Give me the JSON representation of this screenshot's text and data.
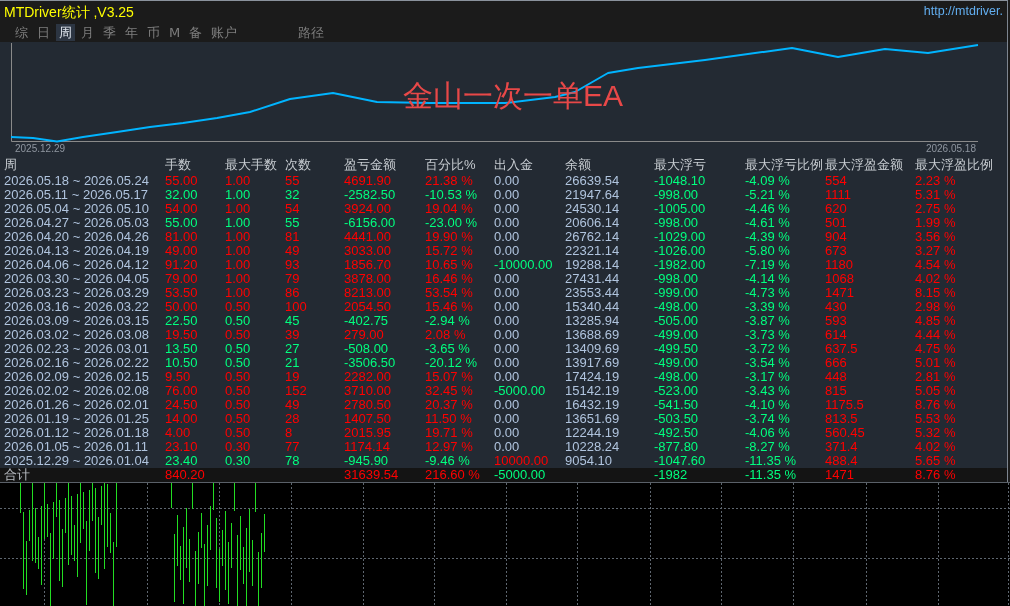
{
  "window": {
    "title": "MTDriver统计 ,V3.25",
    "url": "http://mtdriver."
  },
  "tabs": [
    {
      "label": "综",
      "selected": false
    },
    {
      "label": "日",
      "selected": false
    },
    {
      "label": "周",
      "selected": true
    },
    {
      "label": "月",
      "selected": false
    },
    {
      "label": "季",
      "selected": false
    },
    {
      "label": "年",
      "selected": false
    },
    {
      "label": "币",
      "selected": false
    },
    {
      "label": "M",
      "selected": false
    },
    {
      "label": "备",
      "selected": false
    },
    {
      "label": "账户",
      "selected": false
    }
  ],
  "tool_tabs": [
    {
      "label": "路径",
      "selected": false
    }
  ],
  "equity_chart": {
    "title": "金山一次一单EA",
    "x_start_label": "2025.12.29",
    "x_end_label": "2026.05.18"
  },
  "table": {
    "columns": [
      "周",
      "手数",
      "最大手数",
      "次数",
      "盈亏金额",
      "百分比%",
      "出入金",
      "余额",
      "最大浮亏",
      "最大浮亏比例",
      "最大浮盈金额",
      "最大浮盈比例"
    ],
    "rows": [
      {
        "week": "2026.05.18 ~ 2026.05.24",
        "color": "#ff0000",
        "lots": "55.00",
        "max_lots": "1.00",
        "trades": "55",
        "profit": "4691.90",
        "percent": "21.38 %",
        "deposit": {
          "text": "0.00",
          "color": "#b0c4de"
        },
        "balance": "26639.54",
        "max_float_loss": "-1048.10",
        "max_float_loss_pct": "-4.09 %",
        "max_float_profit": "554",
        "max_float_profit_pct": "2.23 %"
      },
      {
        "week": "2026.05.11 ~ 2026.05.17",
        "color": "#00ff7f",
        "lots": "32.00",
        "max_lots": "1.00",
        "trades": "32",
        "profit": "-2582.50",
        "percent": "-10.53 %",
        "deposit": {
          "text": "0.00",
          "color": "#b0c4de"
        },
        "balance": "21947.64",
        "max_float_loss": "-998.00",
        "max_float_loss_pct": "-5.21 %",
        "max_float_profit": "1111",
        "max_float_profit_pct": "5.31 %"
      },
      {
        "week": "2026.05.04 ~ 2026.05.10",
        "color": "#ff0000",
        "lots": "54.00",
        "max_lots": "1.00",
        "trades": "54",
        "profit": "3924.00",
        "percent": "19.04 %",
        "deposit": {
          "text": "0.00",
          "color": "#b0c4de"
        },
        "balance": "24530.14",
        "max_float_loss": "-1005.00",
        "max_float_loss_pct": "-4.46 %",
        "max_float_profit": "620",
        "max_float_profit_pct": "2.75 %"
      },
      {
        "week": "2026.04.27 ~ 2026.05.03",
        "color": "#00ff7f",
        "lots": "55.00",
        "max_lots": "1.00",
        "trades": "55",
        "profit": "-6156.00",
        "percent": "-23.00 %",
        "deposit": {
          "text": "0.00",
          "color": "#b0c4de"
        },
        "balance": "20606.14",
        "max_float_loss": "-998.00",
        "max_float_loss_pct": "-4.61 %",
        "max_float_profit": "501",
        "max_float_profit_pct": "1.99 %"
      },
      {
        "week": "2026.04.20 ~ 2026.04.26",
        "color": "#ff0000",
        "lots": "81.00",
        "max_lots": "1.00",
        "trades": "81",
        "profit": "4441.00",
        "percent": "19.90 %",
        "deposit": {
          "text": "0.00",
          "color": "#b0c4de"
        },
        "balance": "26762.14",
        "max_float_loss": "-1029.00",
        "max_float_loss_pct": "-4.39 %",
        "max_float_profit": "904",
        "max_float_profit_pct": "3.56 %"
      },
      {
        "week": "2026.04.13 ~ 2026.04.19",
        "color": "#ff0000",
        "lots": "49.00",
        "max_lots": "1.00",
        "trades": "49",
        "profit": "3033.00",
        "percent": "15.72 %",
        "deposit": {
          "text": "0.00",
          "color": "#b0c4de"
        },
        "balance": "22321.14",
        "max_float_loss": "-1026.00",
        "max_float_loss_pct": "-5.80 %",
        "max_float_profit": "673",
        "max_float_profit_pct": "3.27 %"
      },
      {
        "week": "2026.04.06 ~ 2026.04.12",
        "color": "#ff0000",
        "lots": "91.20",
        "max_lots": "1.00",
        "trades": "93",
        "profit": "1856.70",
        "percent": "10.65 %",
        "deposit": {
          "text": "-10000.00",
          "color": "#00ff7f"
        },
        "balance": "19288.14",
        "max_float_loss": "-1982.00",
        "max_float_loss_pct": "-7.19 %",
        "max_float_profit": "1180",
        "max_float_profit_pct": "4.54 %"
      },
      {
        "week": "2026.03.30 ~ 2026.04.05",
        "color": "#ff0000",
        "lots": "79.00",
        "max_lots": "1.00",
        "trades": "79",
        "profit": "3878.00",
        "percent": "16.46 %",
        "deposit": {
          "text": "0.00",
          "color": "#b0c4de"
        },
        "balance": "27431.44",
        "max_float_loss": "-998.00",
        "max_float_loss_pct": "-4.14 %",
        "max_float_profit": "1068",
        "max_float_profit_pct": "4.02 %"
      },
      {
        "week": "2026.03.23 ~ 2026.03.29",
        "color": "#ff0000",
        "lots": "53.50",
        "max_lots": "1.00",
        "trades": "86",
        "profit": "8213.00",
        "percent": "53.54 %",
        "deposit": {
          "text": "0.00",
          "color": "#b0c4de"
        },
        "balance": "23553.44",
        "max_float_loss": "-999.00",
        "max_float_loss_pct": "-4.73 %",
        "max_float_profit": "1471",
        "max_float_profit_pct": "8.15 %"
      },
      {
        "week": "2026.03.16 ~ 2026.03.22",
        "color": "#ff0000",
        "lots": "50.00",
        "max_lots": "0.50",
        "trades": "100",
        "profit": "2054.50",
        "percent": "15.46 %",
        "deposit": {
          "text": "0.00",
          "color": "#b0c4de"
        },
        "balance": "15340.44",
        "max_float_loss": "-498.00",
        "max_float_loss_pct": "-3.39 %",
        "max_float_profit": "430",
        "max_float_profit_pct": "2.98 %"
      },
      {
        "week": "2026.03.09 ~ 2026.03.15",
        "color": "#00ff7f",
        "lots": "22.50",
        "max_lots": "0.50",
        "trades": "45",
        "profit": "-402.75",
        "percent": "-2.94 %",
        "deposit": {
          "text": "0.00",
          "color": "#b0c4de"
        },
        "balance": "13285.94",
        "max_float_loss": "-505.00",
        "max_float_loss_pct": "-3.87 %",
        "max_float_profit": "593",
        "max_float_profit_pct": "4.85 %"
      },
      {
        "week": "2026.03.02 ~ 2026.03.08",
        "color": "#ff0000",
        "lots": "19.50",
        "max_lots": "0.50",
        "trades": "39",
        "profit": "279.00",
        "percent": "2.08 %",
        "deposit": {
          "text": "0.00",
          "color": "#b0c4de"
        },
        "balance": "13688.69",
        "max_float_loss": "-499.00",
        "max_float_loss_pct": "-3.73 %",
        "max_float_profit": "614",
        "max_float_profit_pct": "4.44 %"
      },
      {
        "week": "2026.02.23 ~ 2026.03.01",
        "color": "#00ff7f",
        "lots": "13.50",
        "max_lots": "0.50",
        "trades": "27",
        "profit": "-508.00",
        "percent": "-3.65 %",
        "deposit": {
          "text": "0.00",
          "color": "#b0c4de"
        },
        "balance": "13409.69",
        "max_float_loss": "-499.50",
        "max_float_loss_pct": "-3.72 %",
        "max_float_profit": "637.5",
        "max_float_profit_pct": "4.75 %"
      },
      {
        "week": "2026.02.16 ~ 2026.02.22",
        "color": "#00ff7f",
        "lots": "10.50",
        "max_lots": "0.50",
        "trades": "21",
        "profit": "-3506.50",
        "percent": "-20.12 %",
        "deposit": {
          "text": "0.00",
          "color": "#b0c4de"
        },
        "balance": "13917.69",
        "max_float_loss": "-499.00",
        "max_float_loss_pct": "-3.54 %",
        "max_float_profit": "666",
        "max_float_profit_pct": "5.01 %"
      },
      {
        "week": "2026.02.09 ~ 2026.02.15",
        "color": "#ff0000",
        "lots": "9.50",
        "max_lots": "0.50",
        "trades": "19",
        "profit": "2282.00",
        "percent": "15.07 %",
        "deposit": {
          "text": "0.00",
          "color": "#b0c4de"
        },
        "balance": "17424.19",
        "max_float_loss": "-498.00",
        "max_float_loss_pct": "-3.17 %",
        "max_float_profit": "448",
        "max_float_profit_pct": "2.81 %"
      },
      {
        "week": "2026.02.02 ~ 2026.02.08",
        "color": "#ff0000",
        "lots": "76.00",
        "max_lots": "0.50",
        "trades": "152",
        "profit": "3710.00",
        "percent": "32.45 %",
        "deposit": {
          "text": "-5000.00",
          "color": "#00ff7f"
        },
        "balance": "15142.19",
        "max_float_loss": "-523.00",
        "max_float_loss_pct": "-3.43 %",
        "max_float_profit": "815",
        "max_float_profit_pct": "5.05 %"
      },
      {
        "week": "2026.01.26 ~ 2026.02.01",
        "color": "#ff0000",
        "lots": "24.50",
        "max_lots": "0.50",
        "trades": "49",
        "profit": "2780.50",
        "percent": "20.37 %",
        "deposit": {
          "text": "0.00",
          "color": "#b0c4de"
        },
        "balance": "16432.19",
        "max_float_loss": "-541.50",
        "max_float_loss_pct": "-4.10 %",
        "max_float_profit": "1175.5",
        "max_float_profit_pct": "8.76 %"
      },
      {
        "week": "2026.01.19 ~ 2026.01.25",
        "color": "#ff0000",
        "lots": "14.00",
        "max_lots": "0.50",
        "trades": "28",
        "profit": "1407.50",
        "percent": "11.50 %",
        "deposit": {
          "text": "0.00",
          "color": "#b0c4de"
        },
        "balance": "13651.69",
        "max_float_loss": "-503.50",
        "max_float_loss_pct": "-3.74 %",
        "max_float_profit": "813.5",
        "max_float_profit_pct": "5.53 %"
      },
      {
        "week": "2026.01.12 ~ 2026.01.18",
        "color": "#ff0000",
        "lots": "4.00",
        "max_lots": "0.50",
        "trades": "8",
        "profit": "2015.95",
        "percent": "19.71 %",
        "deposit": {
          "text": "0.00",
          "color": "#b0c4de"
        },
        "balance": "12244.19",
        "max_float_loss": "-492.50",
        "max_float_loss_pct": "-4.06 %",
        "max_float_profit": "560.45",
        "max_float_profit_pct": "5.32 %"
      },
      {
        "week": "2026.01.05 ~ 2026.01.11",
        "color": "#ff0000",
        "lots": "23.10",
        "max_lots": "0.30",
        "trades": "77",
        "profit": "1174.14",
        "percent": "12.97 %",
        "deposit": {
          "text": "0.00",
          "color": "#b0c4de"
        },
        "balance": "10228.24",
        "max_float_loss": "-877.80",
        "max_float_loss_pct": "-8.27 %",
        "max_float_profit": "371.4",
        "max_float_profit_pct": "4.02 %"
      },
      {
        "week": "2025.12.29 ~ 2026.01.04",
        "color": "#00ff7f",
        "lots": "23.40",
        "max_lots": "0.30",
        "trades": "78",
        "profit": "-945.90",
        "percent": "-9.46 %",
        "deposit": {
          "text": "10000.00",
          "color": "#ff0000"
        },
        "balance": "9054.10",
        "max_float_loss": "-1047.60",
        "max_float_loss_pct": "-11.35 %",
        "max_float_profit": "488.4",
        "max_float_profit_pct": "5.65 %"
      }
    ],
    "total": {
      "label": "合计",
      "color": "#ff0000",
      "lots": "840.20",
      "profit": "31639.54",
      "percent": "216.60 %",
      "deposit": {
        "text": "-5000.00",
        "color": "#00ff7f"
      },
      "max_float_loss": "-1982",
      "max_float_loss_pct": "-11.35 %",
      "max_float_profit": "1471",
      "max_float_profit_pct": "8.76 %"
    }
  }
}
